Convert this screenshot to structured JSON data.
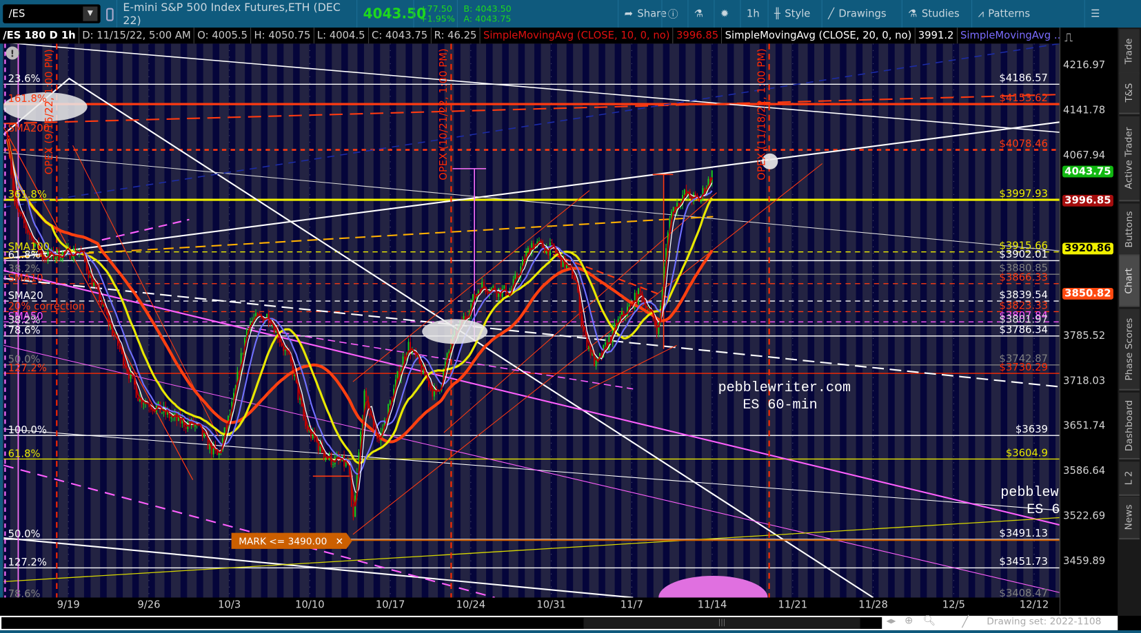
{
  "toolbar": {
    "symbol": "/ES",
    "description": "E-mini S&P 500 Index Futures,ETH (DEC 22)",
    "last": "4043.50",
    "change": "+77.50",
    "change_pct": "+1.95%",
    "bid": "B: 4043.50",
    "ask": "A: 4043.75",
    "share": "Share",
    "timeframe": "1h",
    "style": "Style",
    "drawings": "Drawings",
    "studies": "Studies",
    "patterns": "Patterns"
  },
  "infobar": {
    "title": "/ES 180 D 1h",
    "date": "D: 11/15/22, 5:00 AM",
    "open": "O: 4005.5",
    "high": "H: 4050.75",
    "low": "L: 4004.5",
    "close": "C: 4043.75",
    "range": "R: 46.25",
    "sma10_label": "SimpleMovingAvg (CLOSE, 10, 0, no)",
    "sma10_value": "3996.85",
    "sma20_label": "SimpleMovingAvg (CLOSE, 20, 0, no)",
    "sma20_value": "3991.2",
    "sma_more": "SimpleMovingAvg ..."
  },
  "price_axis": {
    "ticks": [
      "4216.97",
      "4141.78",
      "4067.94",
      "3785.52",
      "3718.03",
      "3651.74",
      "3586.64",
      "3522.69",
      "3459.89"
    ],
    "badges": [
      {
        "text": "4043.75",
        "bg": "#11b811",
        "fg": "#ffffff",
        "price": 4043.75
      },
      {
        "text": "3996.85",
        "bg": "#a50d0d",
        "fg": "#ffffff",
        "price": 3996.85
      },
      {
        "text": "3920.86",
        "bg": "#f0f000",
        "fg": "#000000",
        "price": 3920.86
      },
      {
        "text": "3850.82",
        "bg": "#ff4a10",
        "fg": "#ffffff",
        "price": 3850.82
      }
    ]
  },
  "date_axis": [
    "9/19",
    "9/26",
    "10/3",
    "10/10",
    "10/17",
    "10/24",
    "10/31",
    "11/7",
    "11/14",
    "11/21",
    "11/28",
    "12/5",
    "12/12"
  ],
  "sidebar": [
    "Trade",
    "T&S",
    "Active Trader",
    "Buttons",
    "Chart",
    "Phase Scores",
    "Dashboard",
    "L 2",
    "News"
  ],
  "levels": [
    {
      "price": 4186.57,
      "label": "$4186.57",
      "color": "#ffffff",
      "style": "solid"
    },
    {
      "price": 4153.62,
      "label": "$4153.62",
      "color": "#ff3a10",
      "style": "thick"
    },
    {
      "price": 4078.46,
      "label": "$4078.46",
      "color": "#ff3a10",
      "style": "dotted"
    },
    {
      "price": 3997.93,
      "label": "$3997.93",
      "color": "#f0f000",
      "style": "thick"
    },
    {
      "price": 3915.66,
      "label": "$3915.66",
      "color": "#f0f000",
      "style": "dashed"
    },
    {
      "price": 3902.01,
      "label": "$3902.01",
      "color": "#ffffff",
      "style": "solid"
    },
    {
      "price": 3880.85,
      "label": "$3880.85",
      "color": "#808080",
      "style": "solid"
    },
    {
      "price": 3866.33,
      "label": "$3866.33",
      "color": "#ff3a10",
      "style": "dashed"
    },
    {
      "price": 3839.54,
      "label": "$3839.54",
      "color": "#ffffff",
      "style": "dashed"
    },
    {
      "price": 3823.33,
      "label": "$3823.33",
      "color": "#ff3a10",
      "style": "dashed"
    },
    {
      "price": 3807.84,
      "label": "$3807.84",
      "color": "#ff55ff",
      "style": "dashed"
    },
    {
      "price": 3801.97,
      "label": "$3801.97",
      "color": "#e0e0e0",
      "style": "solid"
    },
    {
      "price": 3786.34,
      "label": "$3786.34",
      "color": "#ffffff",
      "style": "solid"
    },
    {
      "price": 3742.87,
      "label": "$3742.87",
      "color": "#808080",
      "style": "solid"
    },
    {
      "price": 3730.29,
      "label": "$3730.29",
      "color": "#ff2a00",
      "style": "solid"
    },
    {
      "price": 3639,
      "label": "$3639",
      "color": "#ffffff",
      "style": "solid"
    },
    {
      "price": 3604.9,
      "label": "$3604.9",
      "color": "#e8e800",
      "style": "solid"
    },
    {
      "price": 3491.13,
      "label": "$3491.13",
      "color": "#ffffff",
      "style": "solid"
    },
    {
      "price": 3451.73,
      "label": "$3451.73",
      "color": "#ffffff",
      "style": "solid"
    },
    {
      "price": 3408.47,
      "label": "$3408.47",
      "color": "#808080",
      "style": "solid"
    }
  ],
  "left_labels": [
    {
      "price": 4186.57,
      "text": "23.6%",
      "color": "#ffffff"
    },
    {
      "price": 4153.62,
      "text": "161.8%",
      "color": "#ff3a10"
    },
    {
      "price": 4105,
      "text": "SMA200",
      "color": "#ff3a10"
    },
    {
      "price": 3997.93,
      "text": "361.8%",
      "color": "#e8e800"
    },
    {
      "price": 3915,
      "text": "SMA100",
      "color": "#e8e800"
    },
    {
      "price": 3902.01,
      "text": "61.8%",
      "color": "#ffffff"
    },
    {
      "price": 3880.85,
      "text": "38.2%",
      "color": "#808080"
    },
    {
      "price": 3866.33,
      "text": "SMA10",
      "color": "#ff3a10"
    },
    {
      "price": 3839.54,
      "text": "SMA20",
      "color": "#ffffff"
    },
    {
      "price": 3823.33,
      "text": "20% correction",
      "color": "#ff3a10"
    },
    {
      "price": 3807.84,
      "text": "SMA50",
      "color": "#ff55ff"
    },
    {
      "price": 3801.97,
      "text": "38.2%",
      "color": "#e0e0e0"
    },
    {
      "price": 3786.34,
      "text": "78.6%",
      "color": "#ffffff"
    },
    {
      "price": 3742.87,
      "text": "50.0%",
      "color": "#808080"
    },
    {
      "price": 3730.29,
      "text": "127.2%",
      "color": "#ff3a10"
    },
    {
      "price": 3639,
      "text": "100.0%",
      "color": "#ffffff"
    },
    {
      "price": 3604.9,
      "text": "61.8%",
      "color": "#e8e800"
    },
    {
      "price": 3491.13,
      "text": "50.0%",
      "color": "#ffffff"
    },
    {
      "price": 3451.73,
      "text": "127.2%",
      "color": "#ffffff"
    },
    {
      "price": 3408.47,
      "text": "78.6%",
      "color": "#808080"
    }
  ],
  "opex": [
    "OPEX (9/16/22, 1:00 PM)",
    "OPEX (10/21/22, 1:00 PM)",
    "OPEX (11/18/22, 1:00 PM)"
  ],
  "mark_order": "MARK <= 3490.00",
  "watermark": {
    "line1": "pebblewriter.com",
    "line2": "ES 60-min"
  },
  "drawing_set": "Drawing set: 2022-1108",
  "chart_data": {
    "type": "line",
    "title": "/ES 180 D 1h",
    "x_unit": "days from 9/19/22",
    "price_path": [
      [
        -5.3,
        4107
      ],
      [
        -4.7,
        3985
      ],
      [
        -2.2,
        3907
      ],
      [
        1.0,
        3918
      ],
      [
        3.5,
        3807
      ],
      [
        6.1,
        3696
      ],
      [
        9.2,
        3663
      ],
      [
        11.1,
        3652
      ],
      [
        13.0,
        3607
      ],
      [
        14.3,
        3685
      ],
      [
        15.6,
        3807
      ],
      [
        17.5,
        3818
      ],
      [
        19.4,
        3741
      ],
      [
        20.6,
        3652
      ],
      [
        22.5,
        3607
      ],
      [
        24.4,
        3596
      ],
      [
        24.7,
        3502
      ],
      [
        25.7,
        3696
      ],
      [
        27.0,
        3630
      ],
      [
        29.5,
        3774
      ],
      [
        32.0,
        3696
      ],
      [
        33.3,
        3774
      ],
      [
        35.8,
        3863
      ],
      [
        38.4,
        3852
      ],
      [
        40.3,
        3929
      ],
      [
        42.2,
        3918
      ],
      [
        44.1,
        3874
      ],
      [
        44.7,
        3796
      ],
      [
        45.9,
        3741
      ],
      [
        47.8,
        3807
      ],
      [
        49.7,
        3852
      ],
      [
        51.3,
        3796
      ],
      [
        52.3,
        3974
      ],
      [
        53.5,
        4007
      ],
      [
        54.8,
        3996
      ],
      [
        56.1,
        4043.75
      ]
    ],
    "sma_colors": {
      "sma10": "#b80000",
      "sma20": "#ffffff",
      "sma50": "#7070ff",
      "sma100": "#e8e800",
      "sma200": "#ff4010"
    }
  }
}
